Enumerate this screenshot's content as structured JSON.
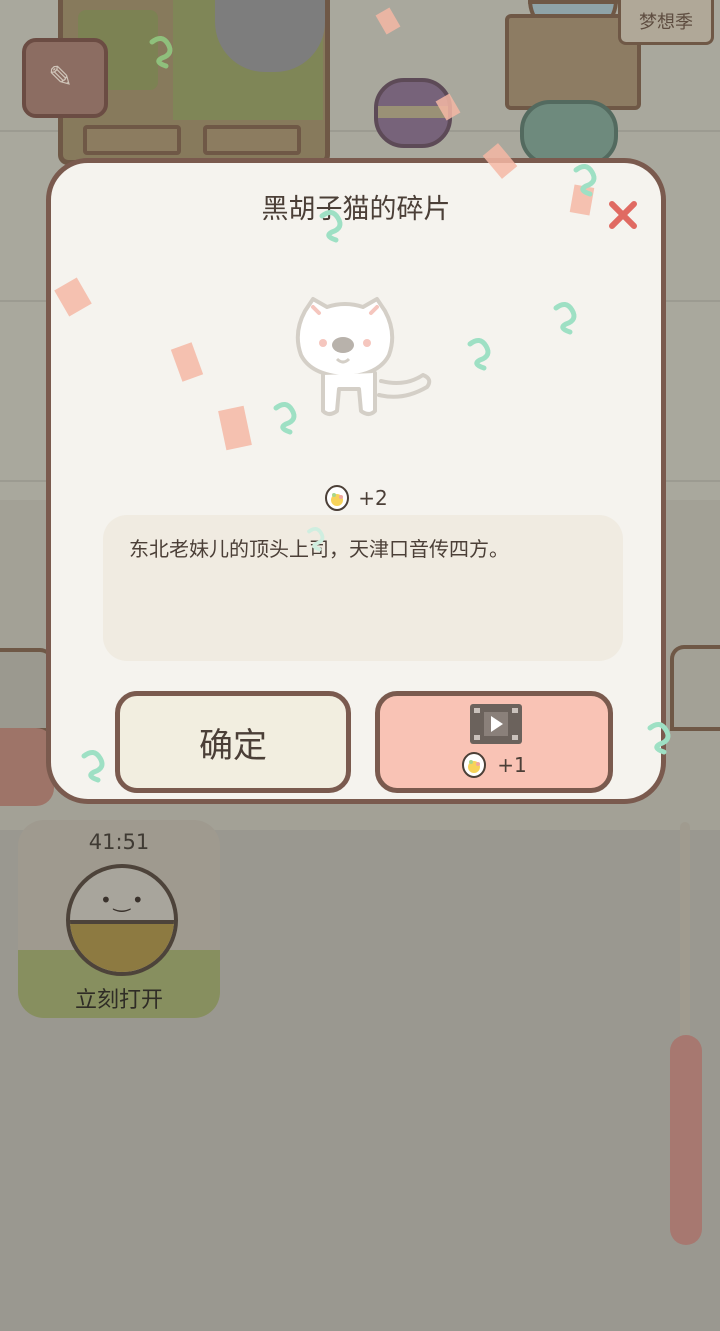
{
  "background": {
    "season_tag": "梦想季",
    "egg_card": {
      "timer": "41:51",
      "open_label": "立刻打开"
    }
  },
  "modal": {
    "title": "黑胡子猫的碎片",
    "reward_text": "+2",
    "description": "东北老妹儿的顶头上司，天津口音传四方。",
    "confirm_label": "确定",
    "video_reward_text": "+1"
  },
  "colors": {
    "modal_border": "#7a5a4e",
    "confirm_bg": "#f2eee0",
    "video_bg": "#f9c3b5",
    "close_icon": "#e06a62"
  }
}
